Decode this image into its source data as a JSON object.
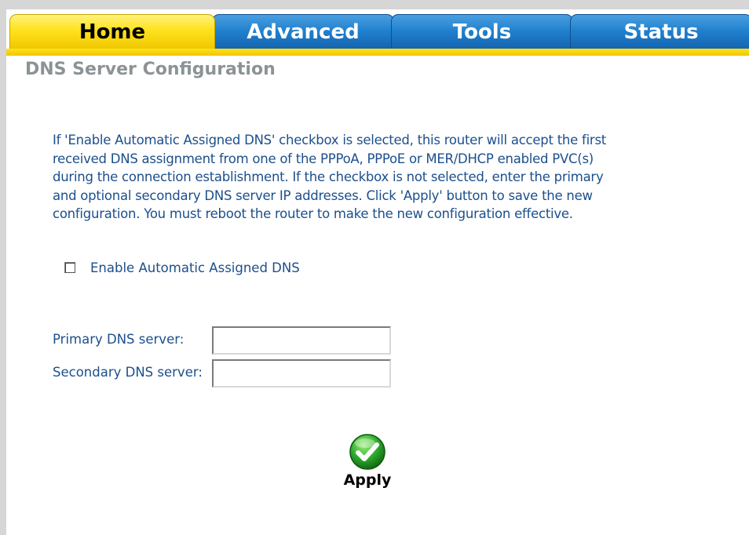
{
  "tabs": [
    {
      "label": "Home",
      "active": true
    },
    {
      "label": "Advanced",
      "active": false
    },
    {
      "label": "Tools",
      "active": false
    },
    {
      "label": "Status",
      "active": false
    }
  ],
  "colors": {
    "active_tab": "#ffe21e",
    "inactive_tab": "#1f7fcd",
    "title_text": "#8c9396",
    "body_text": "#1c4f8c"
  },
  "page": {
    "title": "DNS Server Configuration",
    "description_lines": [
      "If 'Enable Automatic Assigned DNS' checkbox is selected, this router will accept the first",
      "received DNS assignment from one of the PPPoA, PPPoE or MER/DHCP enabled PVC(s)",
      "during the connection establishment. If the checkbox is not selected, enter the primary",
      "and optional secondary DNS server IP addresses. Click 'Apply' button to save the new",
      "configuration. You must reboot the router to make the new configuration effective."
    ]
  },
  "form": {
    "auto_dns": {
      "label": "Enable Automatic Assigned DNS",
      "checked": false
    },
    "primary_dns": {
      "label": "Primary DNS server:",
      "value": ""
    },
    "secondary_dns": {
      "label": "Secondary DNS server:",
      "value": ""
    }
  },
  "apply": {
    "label": "Apply",
    "icon": "checkmark-icon"
  }
}
